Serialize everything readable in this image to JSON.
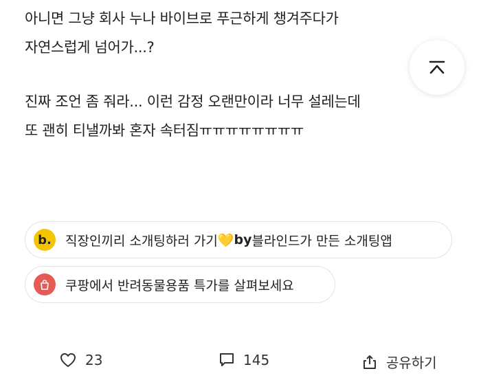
{
  "post": {
    "paragraphs": [
      [
        "아니면 그냥 회사 누나 바이브로 푸근하게 챙겨주다가",
        "자연스럽게 넘어가...?"
      ],
      [
        "진짜 조언 좀 줘라... 이런 감정 오랜만이라 너무 설레는데",
        "또 괜히 티낼까봐 혼자 속터짐ㅠㅠㅠㅠㅠㅠㅠㅠ"
      ]
    ]
  },
  "promos": [
    {
      "icon": "blind-b-icon",
      "icon_letter": "b.",
      "text": "직장인끼리 소개팅하러 가기",
      "emoji": "💛",
      "by": "by",
      "suffix": " 블라인드가 만든 소개팅앱",
      "icon_color": "#f5c400"
    },
    {
      "icon": "shopping-bag-icon",
      "text": "쿠팡에서 반려동물용품 특가를 살펴보세요",
      "icon_color": "#e45a55"
    }
  ],
  "actions": {
    "like_count": "23",
    "comment_count": "145",
    "share_label": "공유하기"
  },
  "scroll_top": {
    "icon": "arrow-up-to-top-icon"
  }
}
